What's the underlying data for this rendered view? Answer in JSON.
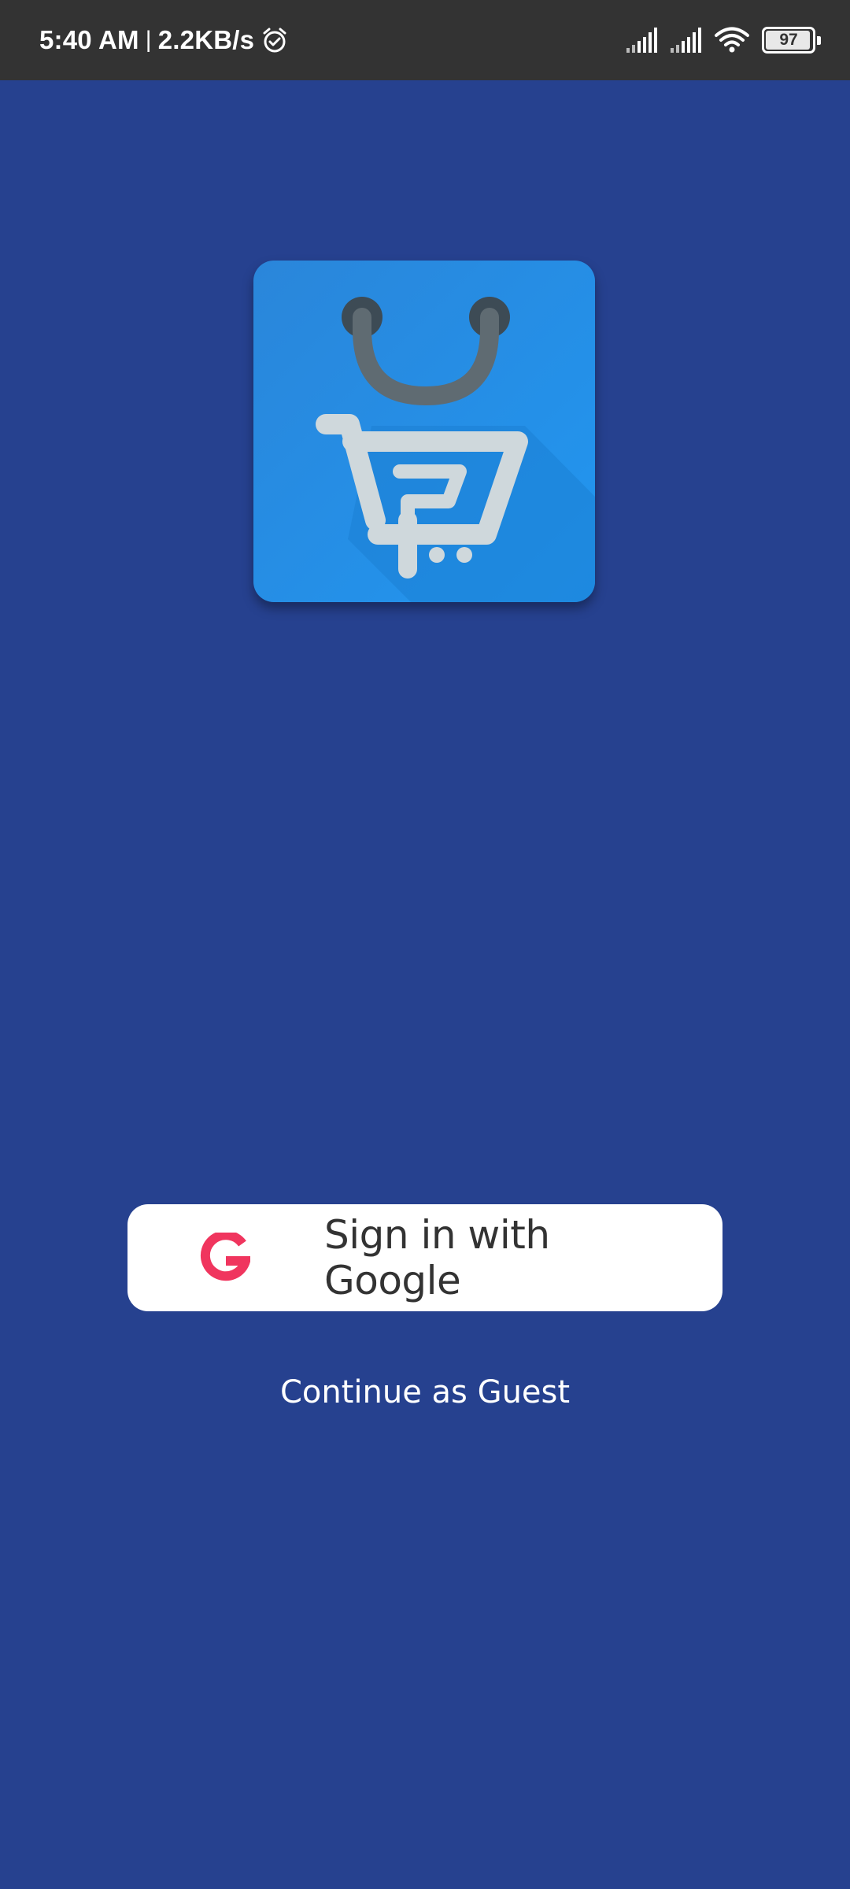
{
  "status_bar": {
    "time": "5:40 AM",
    "separator": "|",
    "net_speed": "2.2KB/s",
    "alarm_icon": "alarm-clock-icon",
    "signal_icons": [
      "cell-signal-icon",
      "cell-signal-icon"
    ],
    "wifi_icon": "wifi-icon",
    "battery_level": "97",
    "battery_fraction": 0.97
  },
  "logo": {
    "icon": "shopping-bag-cart-icon",
    "colors": {
      "tile": "#2c8fe6",
      "handle": "#5f6b72",
      "cart": "#cfd8dc"
    }
  },
  "sign_in": {
    "google_label": "Sign in with Google",
    "google_icon": "google-g-icon",
    "google_icon_color": "#f0355e"
  },
  "guest": {
    "label": "Continue as Guest"
  },
  "colors": {
    "background": "#26418f",
    "status_bar": "#333333",
    "button_bg": "#ffffff",
    "button_text": "#333333"
  }
}
